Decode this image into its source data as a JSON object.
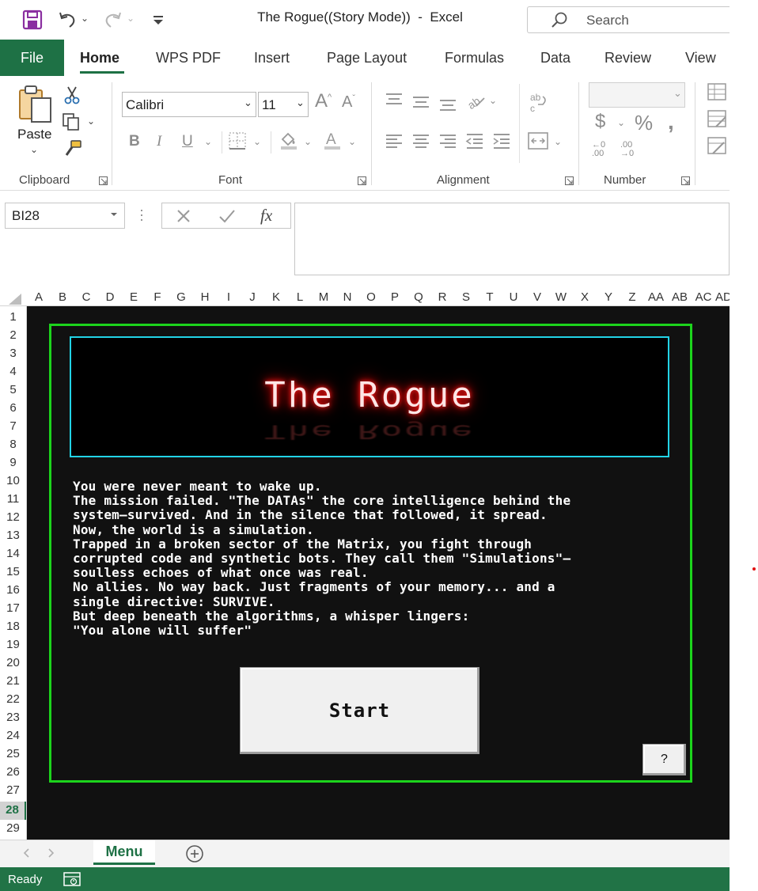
{
  "titlebar": {
    "doc_title": "The Rogue((Story Mode))  -  Excel",
    "search_placeholder": "Search"
  },
  "ribbon_tabs": [
    {
      "label": "File"
    },
    {
      "label": "Home"
    },
    {
      "label": "WPS PDF"
    },
    {
      "label": "Insert"
    },
    {
      "label": "Page Layout"
    },
    {
      "label": "Formulas"
    },
    {
      "label": "Data"
    },
    {
      "label": "Review"
    },
    {
      "label": "View"
    }
  ],
  "ribbon": {
    "clipboard": {
      "paste_label": "Paste",
      "group_label": "Clipboard"
    },
    "font": {
      "font_name": "Calibri",
      "font_size": "11",
      "group_label": "Font"
    },
    "alignment": {
      "group_label": "Alignment"
    },
    "number": {
      "format_value": "",
      "group_label": "Number"
    }
  },
  "formula_bar": {
    "name_box": "BI28",
    "fx_label": "fx",
    "formula": ""
  },
  "columns": [
    "A",
    "B",
    "C",
    "D",
    "E",
    "F",
    "G",
    "H",
    "I",
    "J",
    "K",
    "L",
    "M",
    "N",
    "O",
    "P",
    "Q",
    "R",
    "S",
    "T",
    "U",
    "V",
    "W",
    "X",
    "Y",
    "Z",
    "AA",
    "AB",
    "AC",
    "AD"
  ],
  "rows": [
    "1",
    "2",
    "3",
    "4",
    "5",
    "6",
    "7",
    "8",
    "9",
    "10",
    "11",
    "12",
    "13",
    "14",
    "15",
    "16",
    "17",
    "18",
    "19",
    "20",
    "21",
    "22",
    "23",
    "24",
    "25",
    "26",
    "27",
    "28",
    "29"
  ],
  "selected_row": "28",
  "game": {
    "title": "The Rogue",
    "story": "You were never meant to wake up.\nThe mission failed. \"The DATAs\" the core intelligence behind the\nsystem—survived. And in the silence that followed, it spread.\nNow, the world is a simulation.\nTrapped in a broken sector of the Matrix, you fight through\ncorrupted code and synthetic bots. They call them \"Simulations\"—\nsoulless echoes of what once was real.\nNo allies. No way back. Just fragments of your memory... and a\nsingle directive: SURVIVE.\nBut deep beneath the algorithms, a whisper lingers:\n\"You alone will suffer\"",
    "start_label": "Start",
    "help_label": "?"
  },
  "sheet_tabs": [
    {
      "label": "Menu"
    }
  ],
  "status": {
    "text": "Ready"
  },
  "colors": {
    "excel_green": "#1e7145",
    "frame_green": "#1cd41c",
    "frame_cyan": "#22d3e6",
    "title_glow": "#ff0000",
    "sheet_bg": "#111111"
  }
}
